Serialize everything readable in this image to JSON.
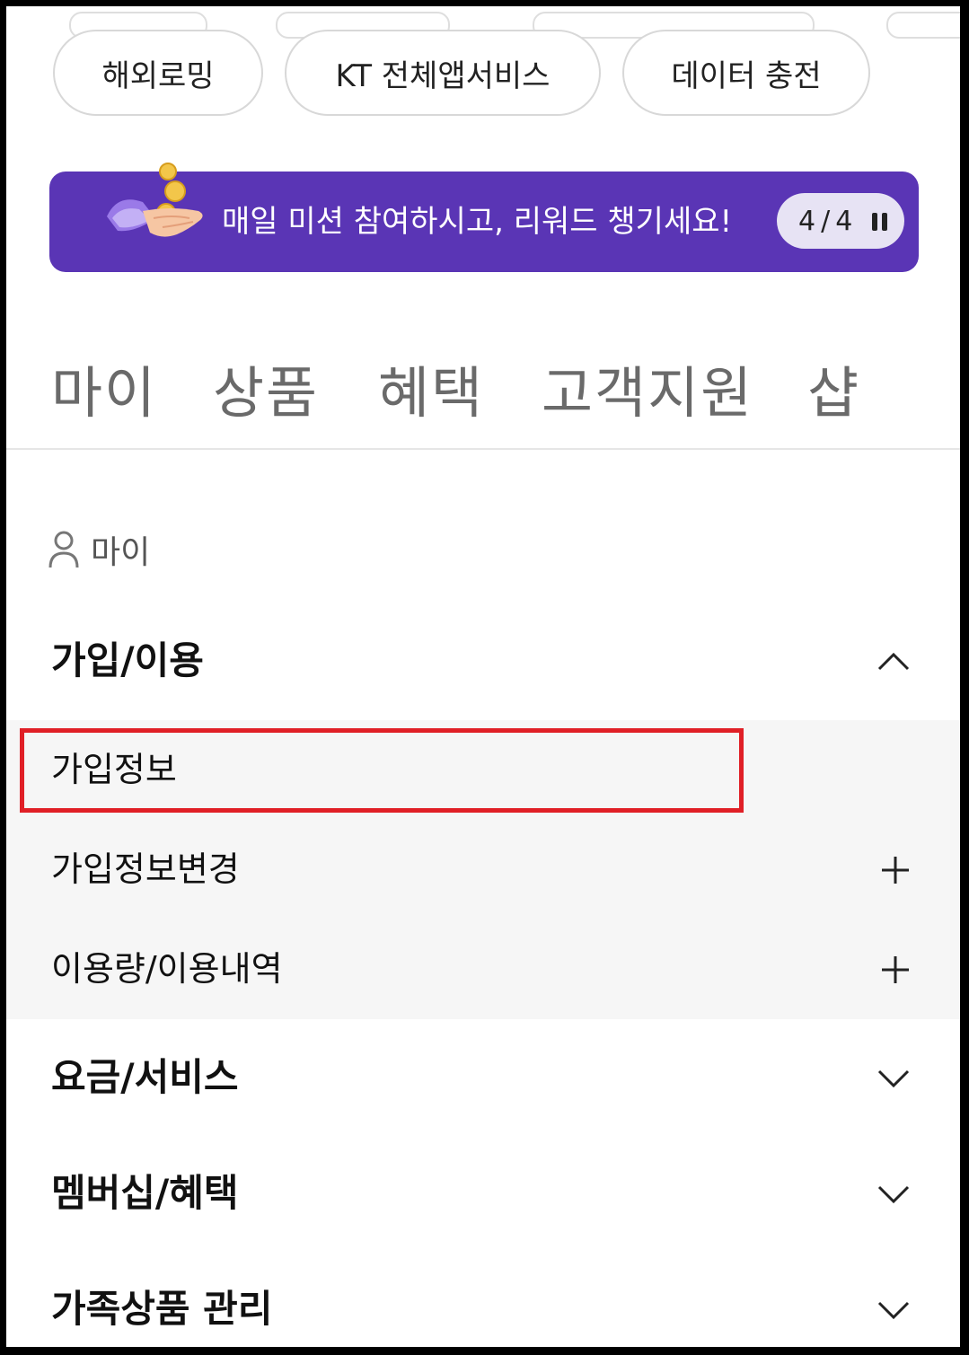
{
  "quick_links": [
    "해외로밍",
    "KT 전체앱서비스",
    "데이터 충전"
  ],
  "banner": {
    "text": "매일 미션 참여하시고, 리워드 챙기세요!",
    "counter": "4/4",
    "background_color": "#5a35b5",
    "icon": "coin-hand-icon"
  },
  "nav_tabs": [
    "마이",
    "상품",
    "혜택",
    "고객지원",
    "샵"
  ],
  "section": {
    "label": "마이",
    "icon": "person-icon"
  },
  "menu": {
    "groups": [
      {
        "label": "가입/이용",
        "expanded": true,
        "items": [
          {
            "label": "가입정보",
            "expandable": false,
            "highlighted": true
          },
          {
            "label": "가입정보변경",
            "expandable": true
          },
          {
            "label": "이용량/이용내역",
            "expandable": true
          }
        ]
      },
      {
        "label": "요금/서비스",
        "expanded": false
      },
      {
        "label": "멤버십/혜택",
        "expanded": false
      },
      {
        "label": "가족상품 관리",
        "expanded": false
      }
    ]
  },
  "highlight_color": "#e01f26"
}
